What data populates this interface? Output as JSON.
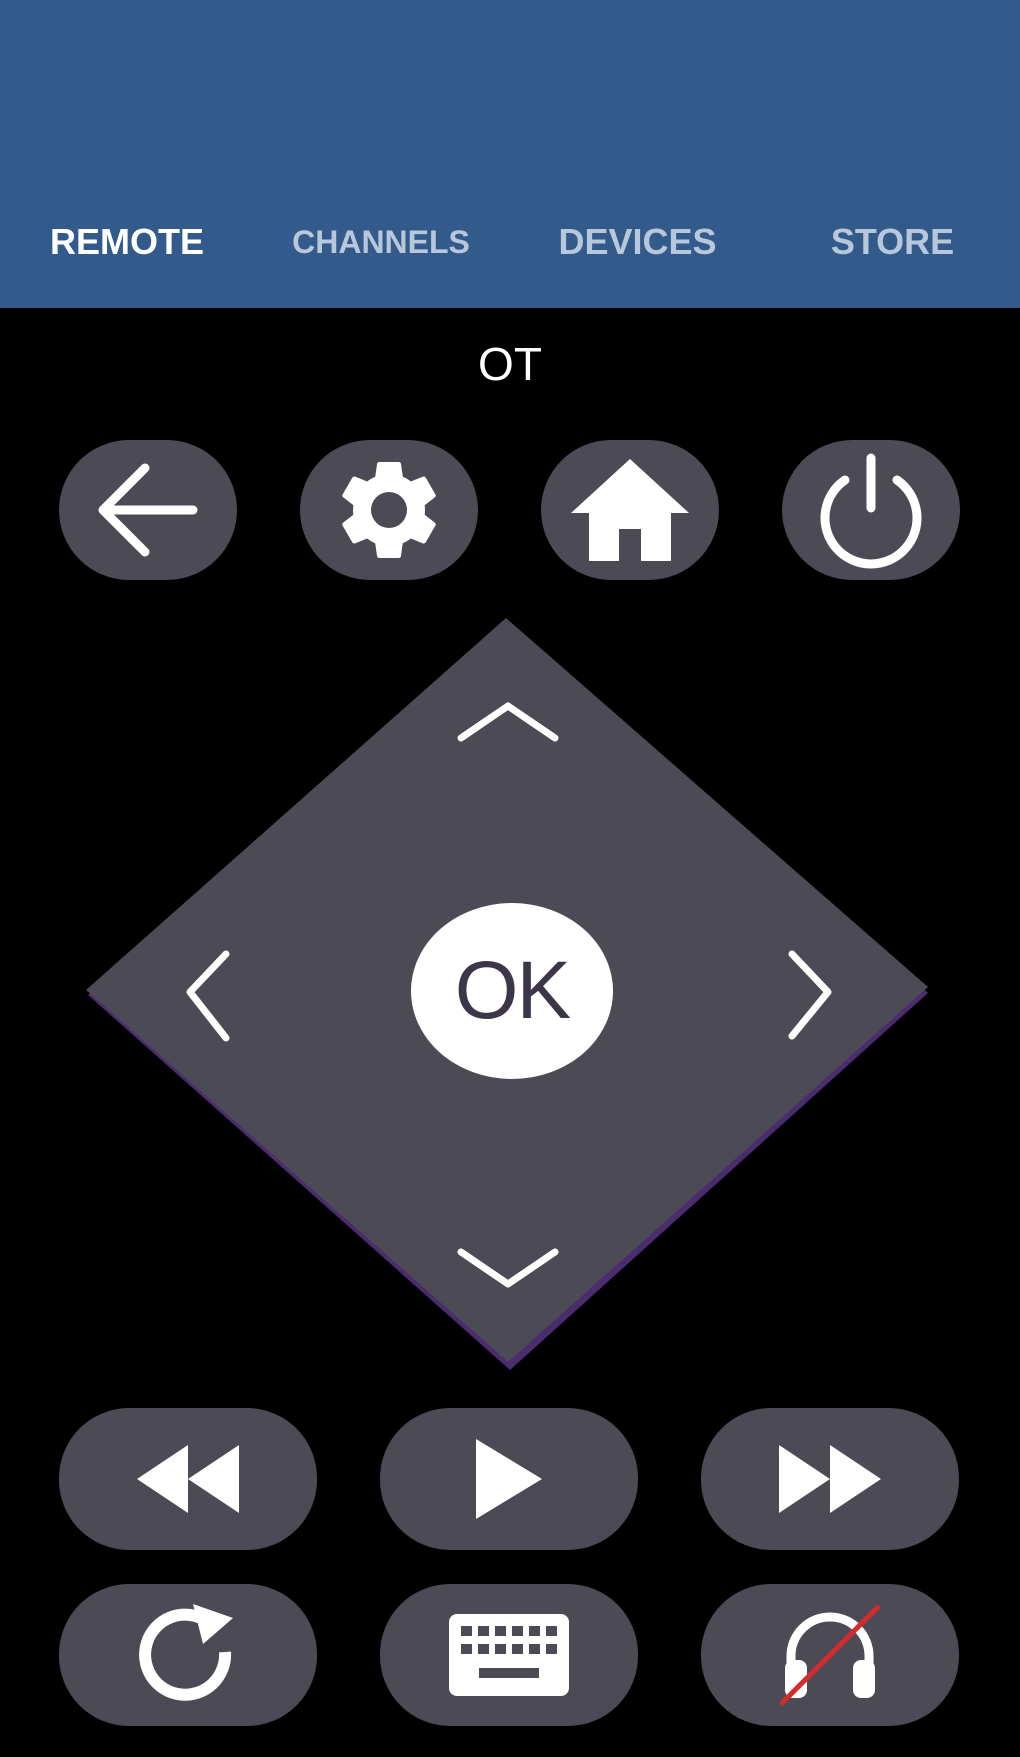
{
  "tabs": [
    {
      "label": "REMOTE",
      "active": true
    },
    {
      "label": "CHANNELS",
      "active": false
    },
    {
      "label": "DEVICES",
      "active": false
    },
    {
      "label": "STORE",
      "active": false
    }
  ],
  "device": {
    "name": "OT"
  },
  "dpad": {
    "ok_label": "OK"
  },
  "colors": {
    "header": "#325b8c",
    "background": "#000000",
    "button": "#4b4a55",
    "dpad_edge": "#4a2d6e",
    "mute_slash": "#d42a2a"
  },
  "icons": {
    "row1": [
      "back-arrow-icon",
      "gear-icon",
      "home-icon",
      "power-icon"
    ],
    "dpad": [
      "chevron-up-icon",
      "chevron-left-icon",
      "chevron-right-icon",
      "chevron-down-icon"
    ],
    "row2": [
      "rewind-icon",
      "play-icon",
      "fast-forward-icon"
    ],
    "row3": [
      "replay-icon",
      "keyboard-icon",
      "headphones-off-icon"
    ]
  }
}
